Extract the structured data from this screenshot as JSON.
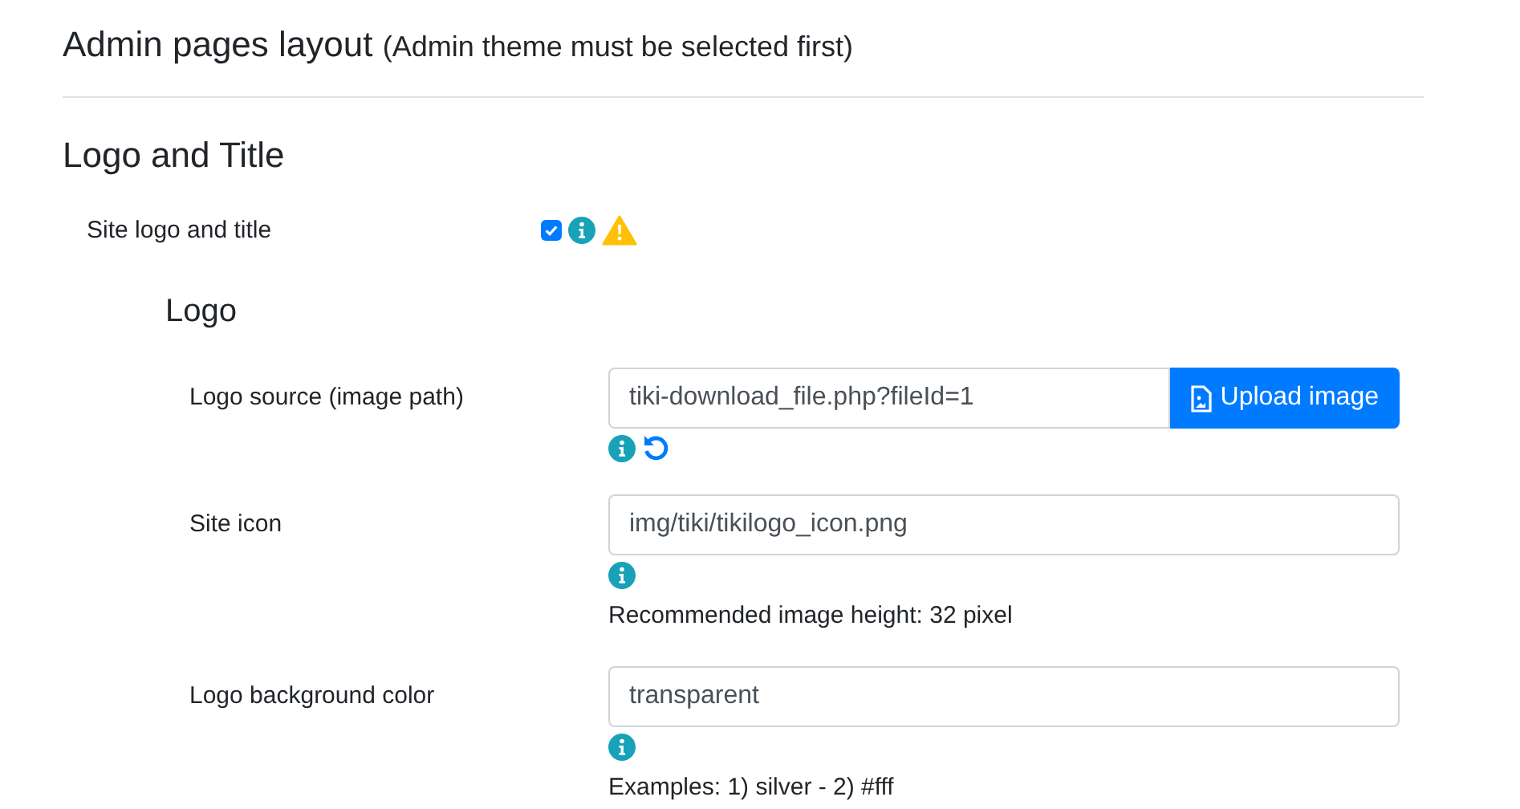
{
  "header": {
    "title": "Admin pages layout",
    "note": "(Admin theme must be selected first)"
  },
  "section": {
    "title": "Logo and Title"
  },
  "feature": {
    "label": "Site logo and title",
    "checked": true,
    "warning": true
  },
  "subsection": {
    "title": "Logo"
  },
  "fields": [
    {
      "kind": "upload",
      "label": "Logo source (image path)",
      "value": "tiki-download_file.php?fileId=1",
      "button": "Upload image",
      "reset": true
    },
    {
      "kind": "text",
      "label": "Site icon",
      "value": "img/tiki/tikilogo_icon.png",
      "reset": false,
      "hint": "Recommended image height: 32 pixel"
    },
    {
      "kind": "text",
      "label": "Logo background color",
      "value": "transparent",
      "reset": false,
      "hint": "Examples: 1) silver - 2) #fff"
    }
  ]
}
